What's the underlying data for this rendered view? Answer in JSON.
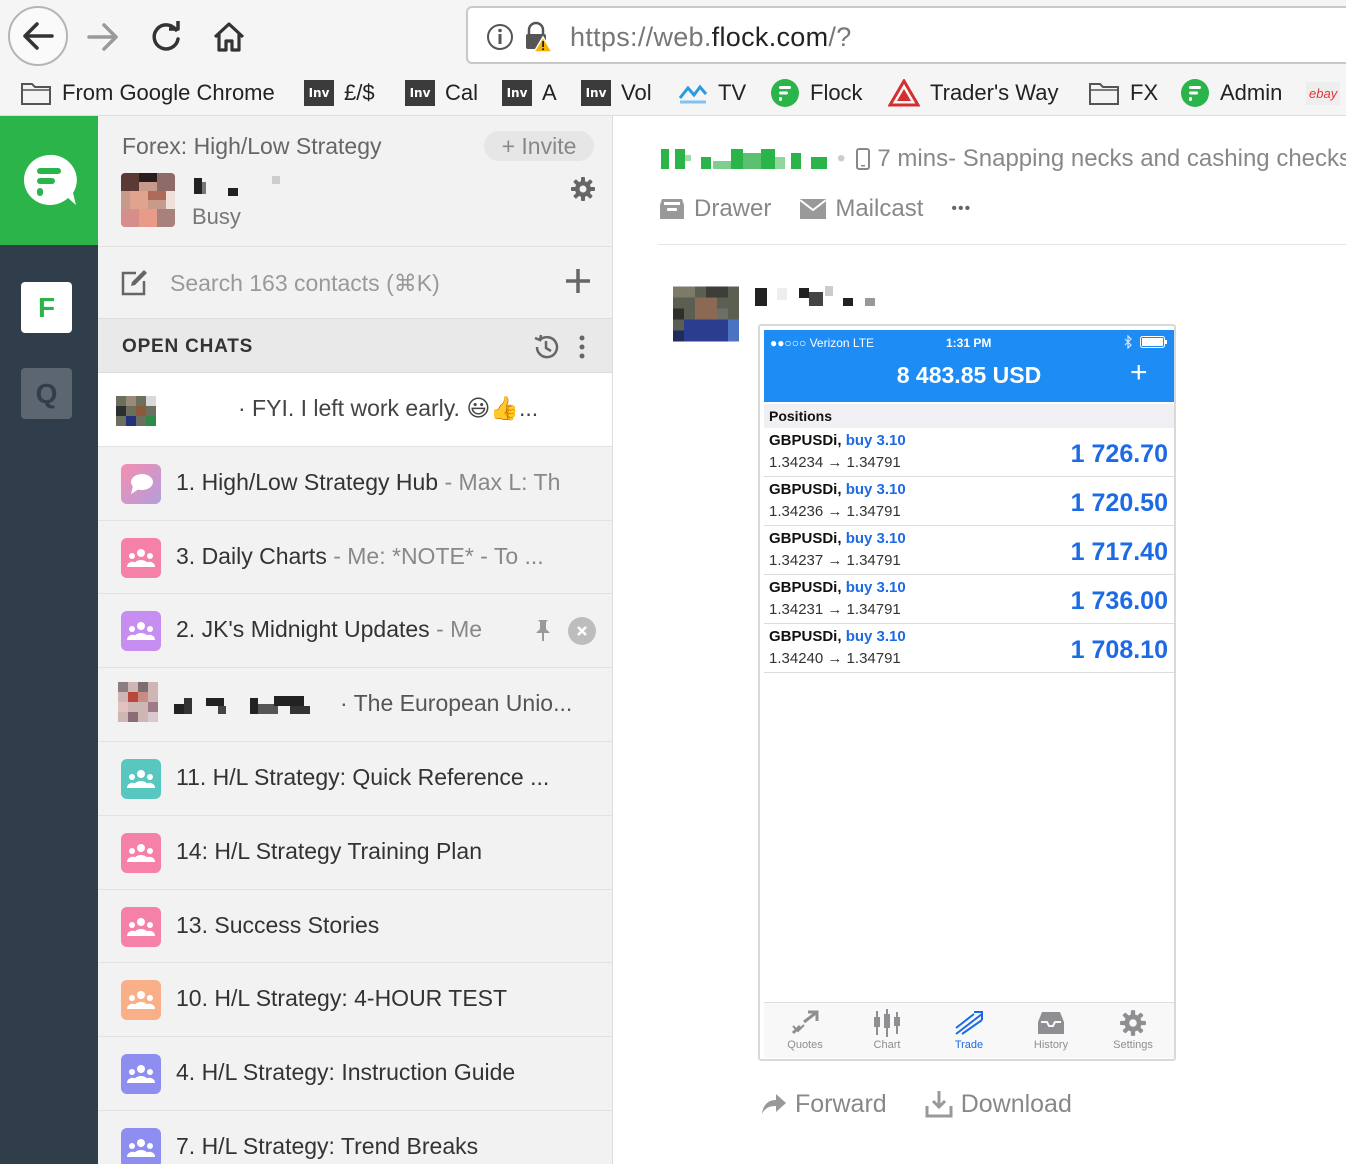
{
  "browser": {
    "url_prefix": "https://web.",
    "url_domain": "flock.com",
    "url_suffix": "/?",
    "bookmarks": [
      {
        "label": "From Google Chrome",
        "icon": "folder-icon"
      },
      {
        "label": "£/$",
        "icon": "inv-icon"
      },
      {
        "label": "Cal",
        "icon": "inv-icon"
      },
      {
        "label": "A",
        "icon": "inv-icon"
      },
      {
        "label": "Vol",
        "icon": "inv-icon"
      },
      {
        "label": "TV",
        "icon": "tradingview-icon"
      },
      {
        "label": "Flock",
        "icon": "flock-icon"
      },
      {
        "label": "Trader's Way",
        "icon": "traders-way-icon"
      },
      {
        "label": "FX",
        "icon": "folder-icon"
      },
      {
        "label": "Admin",
        "icon": "flock-icon"
      }
    ],
    "inv_badge": "Inv",
    "ebay_badge": "ebay"
  },
  "rail": {
    "teams": [
      "F",
      "Q"
    ]
  },
  "sidebar": {
    "team_name": "Forex: High/Low Strategy",
    "invite_label": "+ Invite",
    "user_status": "Busy",
    "search_placeholder": "Search 163 contacts (⌘K)",
    "open_chats_label": "OPEN CHATS",
    "chats": [
      {
        "title": "",
        "sub": "· FYI. I left work early. 😃👍...",
        "color": "",
        "type": "contact"
      },
      {
        "title": "1. High/Low Strategy Hub",
        "sub": " - Max L: Th",
        "color": "#ef8fc0",
        "type": "hub"
      },
      {
        "title": "3. Daily Charts",
        "sub": " - Me: *NOTE* - To ...",
        "color": "#f580a8",
        "type": "group"
      },
      {
        "title": "2. JK's Midnight Updates",
        "sub": " - Me",
        "color": "#c58ef0",
        "type": "group"
      },
      {
        "title": "",
        "sub": "· The European Unio...",
        "color": "",
        "type": "contact"
      },
      {
        "title": "11. H/L Strategy: Quick Reference ...",
        "sub": "",
        "color": "#58c7c0",
        "type": "group"
      },
      {
        "title": "14: H/L Strategy Training Plan",
        "sub": "",
        "color": "#f580a8",
        "type": "group"
      },
      {
        "title": "13. Success Stories",
        "sub": "",
        "color": "#f580a8",
        "type": "group"
      },
      {
        "title": "10. H/L Strategy: 4-HOUR TEST",
        "sub": "",
        "color": "#f9b089",
        "type": "group"
      },
      {
        "title": "4. H/L Strategy: Instruction Guide",
        "sub": "",
        "color": "#8d8ef0",
        "type": "group"
      },
      {
        "title": "7. H/L Strategy: Trend Breaks",
        "sub": "",
        "color": "#8d8ef0",
        "type": "group"
      }
    ]
  },
  "main": {
    "header_time": "7 mins",
    "header_status": " - Snapping necks and cashing checks",
    "tools": [
      "Drawer",
      "Mailcast",
      "•••"
    ],
    "message_actions": [
      "Forward",
      "Download"
    ],
    "phone": {
      "carrier": "●●○○○ Verizon   LTE",
      "time": "1:31 PM",
      "balance": "8 483.85 USD",
      "plus": "+",
      "positions_label": "Positions",
      "positions": [
        {
          "symbol": "GBPUSDi,",
          "direction": "buy 3.10",
          "prices": "1.34234 → 1.34791",
          "profit": "1 726.70"
        },
        {
          "symbol": "GBPUSDi,",
          "direction": "buy 3.10",
          "prices": "1.34236 → 1.34791",
          "profit": "1 720.50"
        },
        {
          "symbol": "GBPUSDi,",
          "direction": "buy 3.10",
          "prices": "1.34237 → 1.34791",
          "profit": "1 717.40"
        },
        {
          "symbol": "GBPUSDi,",
          "direction": "buy 3.10",
          "prices": "1.34231 → 1.34791",
          "profit": "1 736.00"
        },
        {
          "symbol": "GBPUSDi,",
          "direction": "buy 3.10",
          "prices": "1.34240 → 1.34791",
          "profit": "1 708.10"
        }
      ],
      "tabs": [
        "Quotes",
        "Chart",
        "Trade",
        "History",
        "Settings"
      ],
      "selected_tab": "Trade"
    }
  },
  "colors": {
    "flock_green": "#2bb44a",
    "rail_dark": "#2f3e4a",
    "mt_blue": "#1d8cf5"
  }
}
